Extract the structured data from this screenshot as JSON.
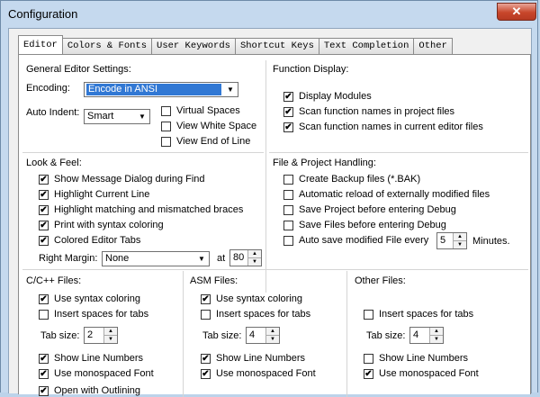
{
  "window": {
    "title": "Configuration",
    "close_label": "✕"
  },
  "tabs": [
    "Editor",
    "Colors & Fonts",
    "User Keywords",
    "Shortcut Keys",
    "Text Completion",
    "Other"
  ],
  "general": {
    "title": "General Editor Settings:",
    "encoding_label": "Encoding:",
    "encoding_value": "Encode in ANSI",
    "auto_indent_label": "Auto Indent:",
    "auto_indent_value": "Smart",
    "virtual_spaces": "Virtual Spaces",
    "view_white_space": "View White Space",
    "view_end_of_line": "View End of Line"
  },
  "function_display": {
    "title": "Function Display:",
    "display_modules": "Display Modules",
    "scan_project": "Scan function names in project files",
    "scan_current": "Scan function names in current editor files"
  },
  "look_feel": {
    "title": "Look & Feel:",
    "items": [
      "Show Message Dialog during Find",
      "Highlight Current Line",
      "Highlight matching and mismatched braces",
      "Print with syntax coloring",
      "Colored Editor Tabs"
    ],
    "right_margin_label": "Right Margin:",
    "right_margin_value": "None",
    "at_label": "at",
    "at_value": "80"
  },
  "file_project": {
    "title": "File & Project Handling:",
    "items": [
      "Create Backup files (*.BAK)",
      "Automatic reload of externally modified files",
      "Save Project before entering Debug",
      "Save Files before entering Debug"
    ],
    "autosave_label": "Auto save modified File every",
    "autosave_value": "5",
    "minutes_label": "Minutes."
  },
  "cpp": {
    "title": "C/C++ Files:",
    "syntax": "Use syntax coloring",
    "spaces": "Insert spaces for tabs",
    "tab_size_label": "Tab size:",
    "tab_size_value": "2",
    "line_numbers": "Show Line Numbers",
    "monospaced": "Use monospaced Font",
    "outlining": "Open with Outlining"
  },
  "asm": {
    "title": "ASM Files:",
    "syntax": "Use syntax coloring",
    "spaces": "Insert spaces for tabs",
    "tab_size_label": "Tab size:",
    "tab_size_value": "4",
    "line_numbers": "Show Line Numbers",
    "monospaced": "Use monospaced Font"
  },
  "other": {
    "title": "Other Files:",
    "spaces": "Insert spaces for tabs",
    "tab_size_label": "Tab size:",
    "tab_size_value": "4",
    "line_numbers": "Show Line Numbers",
    "monospaced": "Use monospaced Font"
  },
  "glyphs": {
    "check": "✔",
    "arrow_down": "▼",
    "arrow_up": "▲"
  }
}
